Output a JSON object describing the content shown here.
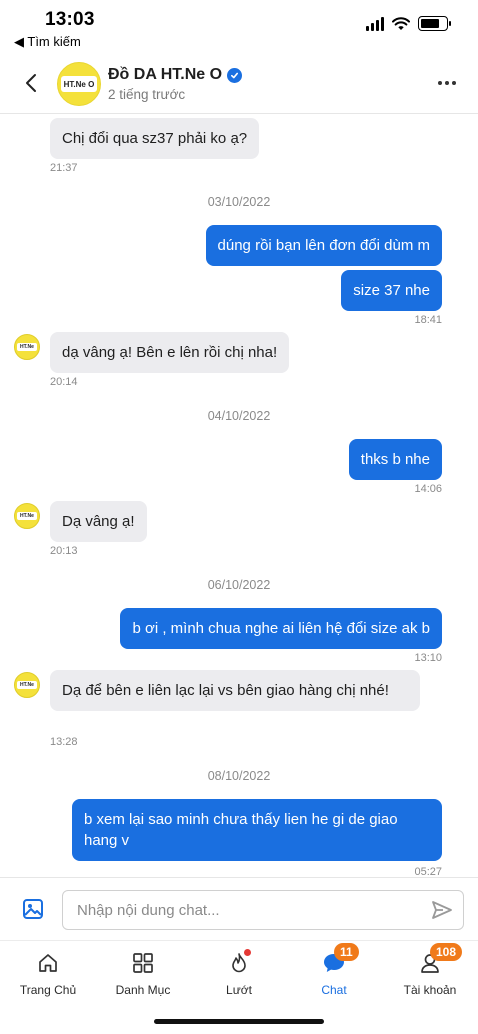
{
  "status_bar": {
    "time": "13:03",
    "back_app": "◀ Tìm kiếm"
  },
  "header": {
    "shop_name": "Đồ DA HT.Ne O",
    "avatar_text": "HT.Ne O",
    "last_seen": "2 tiếng trước"
  },
  "messages": [
    {
      "id": "m1",
      "direction": "in",
      "text": "Chị đổi qua sz37 phải ko ạ?",
      "time": "21:37"
    },
    {
      "id": "d1",
      "type": "date",
      "text": "03/10/2022"
    },
    {
      "id": "m2",
      "direction": "out",
      "text": "dúng rồi bạn lên đơn đổi dùm m"
    },
    {
      "id": "m3",
      "direction": "out",
      "text": "size 37 nhe",
      "time": "18:41"
    },
    {
      "id": "m4",
      "direction": "in",
      "text": "dạ vâng ạ! Bên e lên rồi chị nha!",
      "time": "20:14"
    },
    {
      "id": "d2",
      "type": "date",
      "text": "04/10/2022"
    },
    {
      "id": "m5",
      "direction": "out",
      "text": "thks b nhe",
      "time": "14:06"
    },
    {
      "id": "m6",
      "direction": "in",
      "text": "Dạ vâng ạ!",
      "time": "20:13"
    },
    {
      "id": "d3",
      "type": "date",
      "text": "06/10/2022"
    },
    {
      "id": "m7",
      "direction": "out",
      "text": "b ơi , mình chua nghe ai liên hệ đổi size ak b",
      "time": "13:10"
    },
    {
      "id": "m8",
      "direction": "in",
      "text": "Dạ để bên e liên lạc lại vs bên giao hàng chị nhé!",
      "time": "13:28"
    },
    {
      "id": "d4",
      "type": "date",
      "text": "08/10/2022"
    },
    {
      "id": "m9",
      "direction": "out",
      "text": "b xem lại sao minh chưa thấy lien he gi de giao hang v",
      "time": "05:27"
    }
  ],
  "input": {
    "placeholder": "Nhập nội dung chat..."
  },
  "tabs": [
    {
      "label": "Trang Chủ",
      "icon": "home-icon"
    },
    {
      "label": "Danh Mục",
      "icon": "grid-icon"
    },
    {
      "label": "Lướt",
      "icon": "flame-icon"
    },
    {
      "label": "Chat",
      "icon": "chat-icon",
      "badge": "11",
      "active": true
    },
    {
      "label": "Tài khoản",
      "icon": "user-icon",
      "badge": "108"
    }
  ],
  "colors": {
    "accent": "#1a6fe0",
    "badge": "#f07a1a",
    "incoming_bubble": "#ececef",
    "avatar": "#f4e13b"
  }
}
